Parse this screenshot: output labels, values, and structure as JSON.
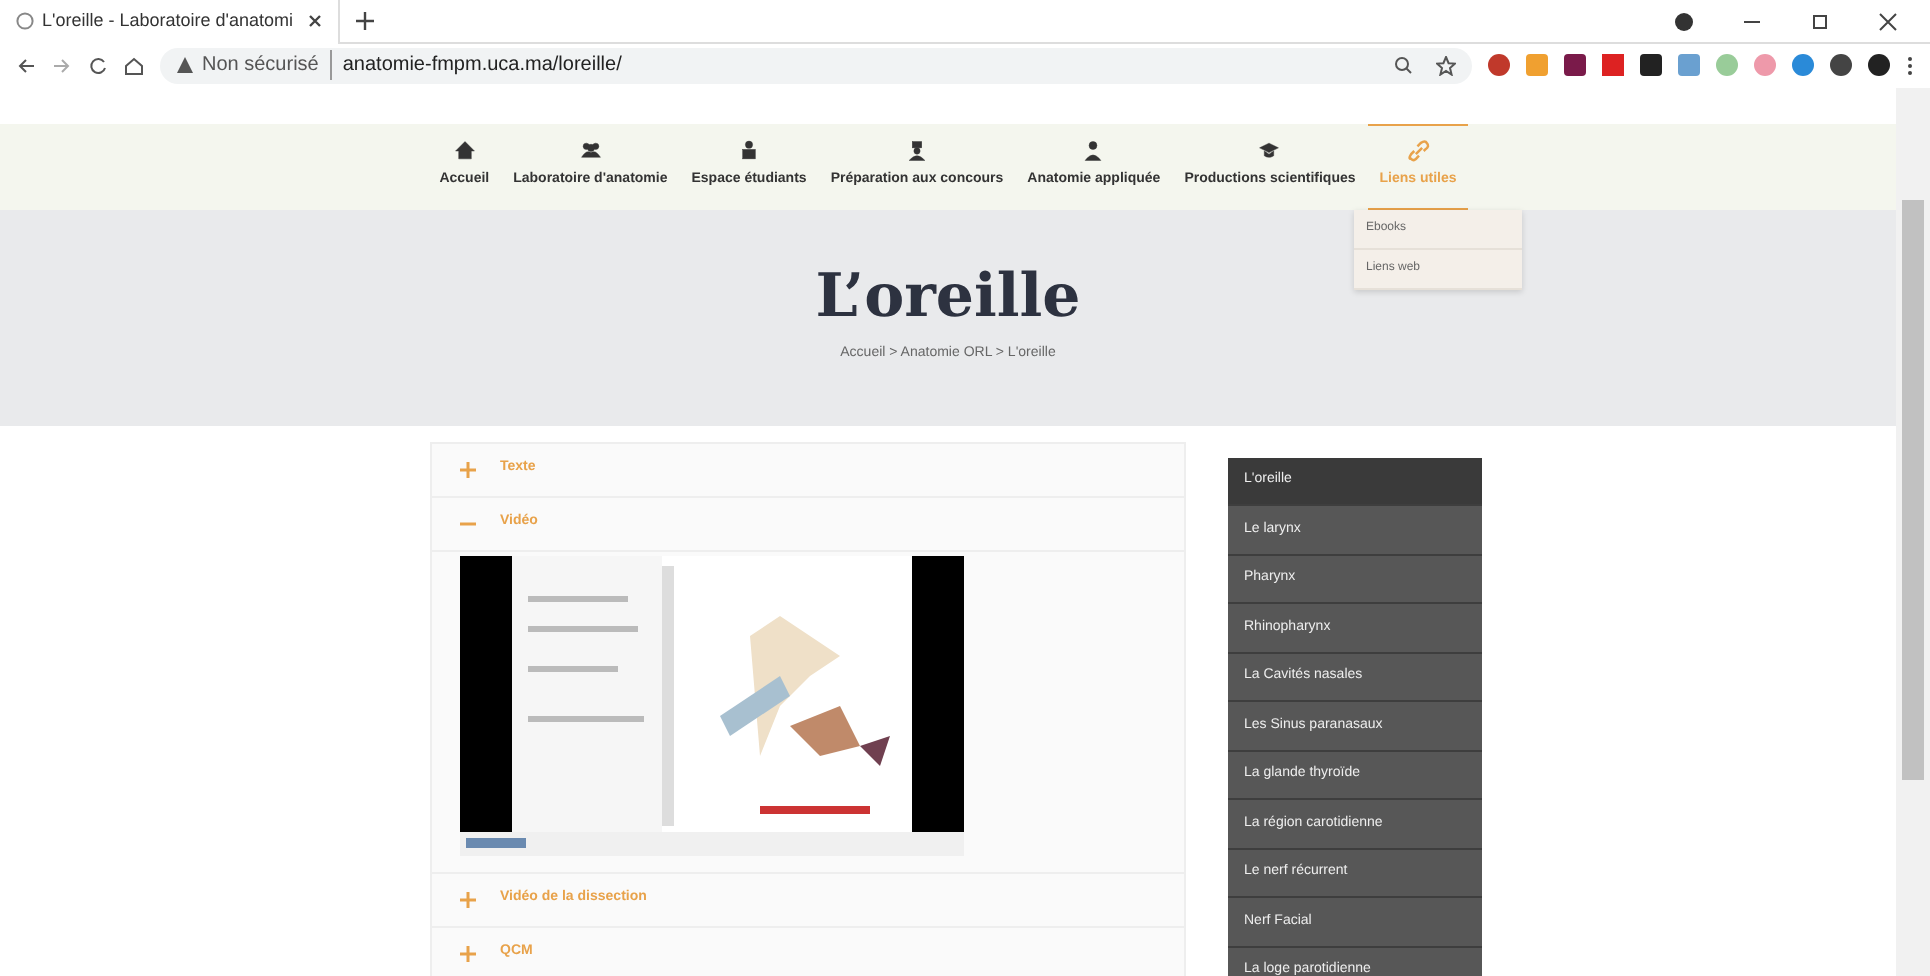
{
  "browser": {
    "tab_title": "L'oreille - Laboratoire d'anatomi",
    "url_warning": "Non sécurisé",
    "url": "anatomie-fmpm.uca.ma/loreille/"
  },
  "nav": {
    "items": [
      {
        "label": "Accueil",
        "selected": false
      },
      {
        "label": "Laboratoire d'anatomie",
        "selected": false
      },
      {
        "label": "Espace étudiants",
        "selected": false
      },
      {
        "label": "Préparation aux concours",
        "selected": false
      },
      {
        "label": "Anatomie appliquée",
        "selected": false
      },
      {
        "label": "Productions scientifiques",
        "selected": false
      },
      {
        "label": "Liens utiles",
        "selected": true
      }
    ],
    "dropdown": [
      "Ebooks",
      "Liens web"
    ]
  },
  "hero": {
    "title": "L’oreille",
    "breadcrumb": "Accueil > Anatomie ORL > L'oreille"
  },
  "accordion": [
    {
      "label": "Texte",
      "expanded": false
    },
    {
      "label": "Vidéo",
      "expanded": true,
      "kind": "picture"
    },
    {
      "label": "Vidéo de la dissection",
      "expanded": false
    },
    {
      "label": "QCM",
      "expanded": false
    }
  ],
  "sidebar": [
    {
      "label": "L'oreille",
      "selected": true
    },
    {
      "label": "Le larynx",
      "selected": false
    },
    {
      "label": "Pharynx",
      "selected": false
    },
    {
      "label": "Rhinopharynx",
      "selected": false
    },
    {
      "label": "La Cavités nasales",
      "selected": false
    },
    {
      "label": "Les Sinus paranasaux",
      "selected": false
    },
    {
      "label": "La glande thyroïde",
      "selected": false
    },
    {
      "label": "La région carotidienne",
      "selected": false
    },
    {
      "label": "Le nerf récurrent",
      "selected": false
    },
    {
      "label": "Nerf Facial",
      "selected": false
    },
    {
      "label": "La loge parotidienne",
      "selected": false
    }
  ]
}
